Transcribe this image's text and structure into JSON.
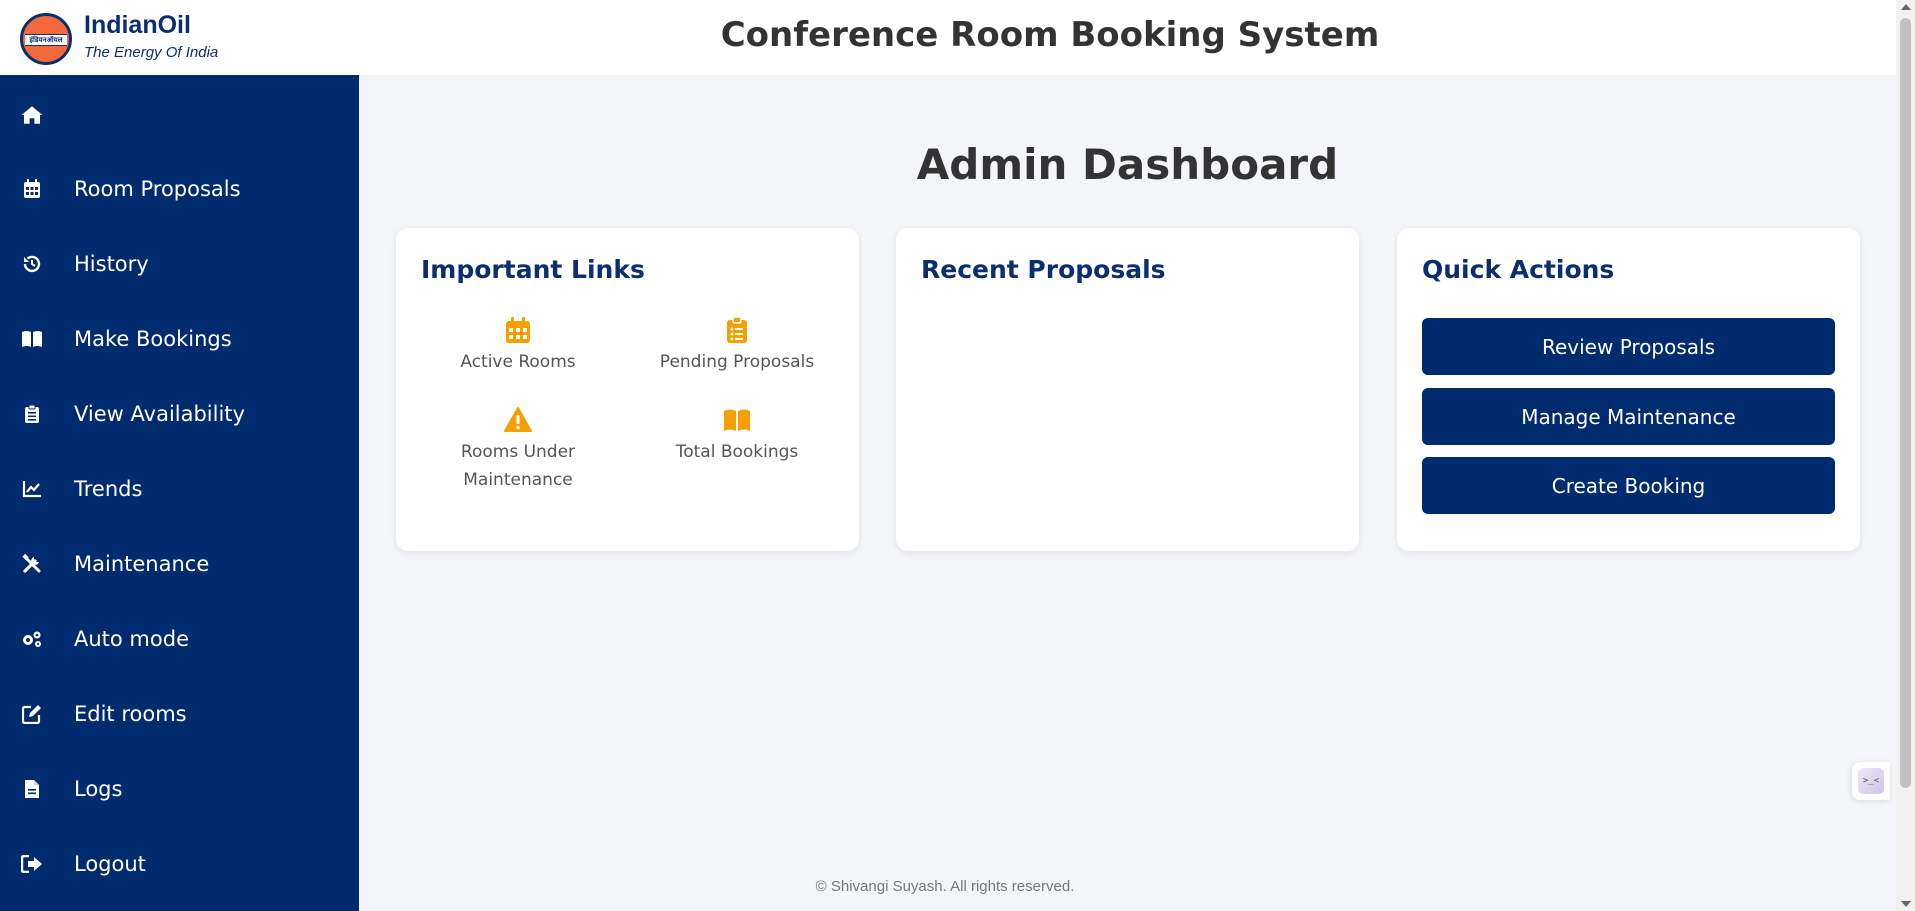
{
  "header": {
    "brand_name": "IndianOil",
    "brand_tagline": "The Energy Of India",
    "logo_text": "इंडियनऑयल",
    "app_title": "Conference Room Booking System"
  },
  "sidebar": {
    "items": [
      {
        "label": "",
        "icon": "home-icon"
      },
      {
        "label": "Room Proposals",
        "icon": "calendar-icon"
      },
      {
        "label": "History",
        "icon": "history-icon"
      },
      {
        "label": "Make Bookings",
        "icon": "book-icon"
      },
      {
        "label": "View Availability",
        "icon": "clipboard-icon"
      },
      {
        "label": "Trends",
        "icon": "chart-line-icon"
      },
      {
        "label": "Maintenance",
        "icon": "tools-icon"
      },
      {
        "label": "Auto mode",
        "icon": "gears-icon"
      },
      {
        "label": "Edit rooms",
        "icon": "edit-icon"
      },
      {
        "label": "Logs",
        "icon": "file-icon"
      },
      {
        "label": "Logout",
        "icon": "sign-out-icon"
      }
    ]
  },
  "main": {
    "page_title": "Admin Dashboard",
    "important_links": {
      "title": "Important Links",
      "items": [
        {
          "label": "Active Rooms",
          "icon": "calendar-icon"
        },
        {
          "label": "Pending Proposals",
          "icon": "clipboard-list-icon"
        },
        {
          "label_line1": "Rooms Under",
          "label_line2": "Maintenance",
          "icon": "warning-icon"
        },
        {
          "label": "Total Bookings",
          "icon": "book-open-icon"
        }
      ]
    },
    "recent_proposals": {
      "title": "Recent Proposals"
    },
    "quick_actions": {
      "title": "Quick Actions",
      "buttons": [
        "Review Proposals",
        "Manage Maintenance",
        "Create Booking"
      ]
    }
  },
  "footer": {
    "text": "© Shivangi Suyash. All rights reserved."
  },
  "floating_widget": {
    "text": ">_<",
    "icon": "assistant-widget-icon"
  },
  "colors": {
    "sidebar_bg": "#002b6f",
    "brand_blue": "#0b2e6f",
    "icon_accent": "#f5a000",
    "page_bg": "#f3f5f8",
    "logo_orange": "#f26a3c"
  }
}
